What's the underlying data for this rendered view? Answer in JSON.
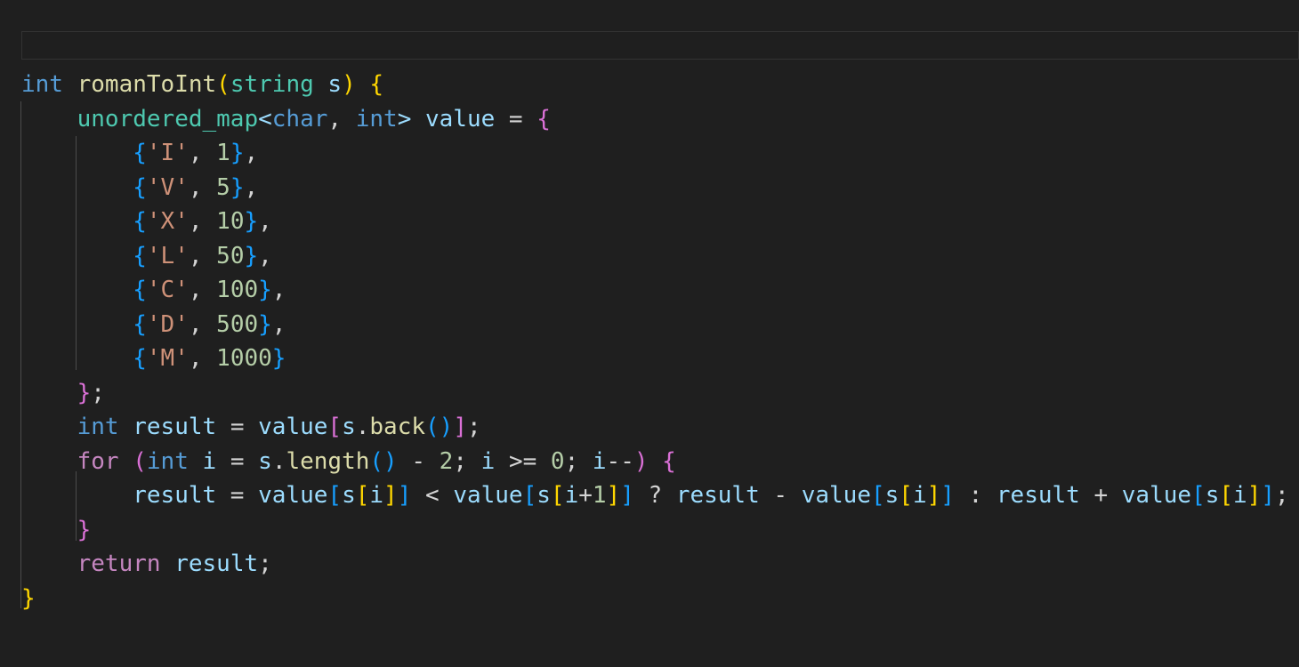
{
  "window": {
    "background_color": "#1f1f1f",
    "app_kind": "code-editor"
  },
  "topbar": {
    "name": "empty-tab-strip",
    "value": "",
    "placeholder": "",
    "border_color": "#333333"
  },
  "editor": {
    "language": "cpp",
    "font_size_px": 26,
    "line_height_px": 38.5,
    "theme": "Dark Modern",
    "indent_guides": true,
    "colors": {
      "keyword": "#569cd6",
      "control": "#c586c0",
      "type": "#4ec9b0",
      "function": "#dcdcaa",
      "variable": "#9cdcfe",
      "number": "#b5cea8",
      "string": "#ce9178",
      "operator": "#d4d4d4",
      "bracket_level_1": "#ffd700",
      "bracket_level_2": "#da70d6",
      "bracket_level_3": "#179fff",
      "indent_guide": "#4b4b4b",
      "background": "#1f1f1f"
    },
    "lines": [
      "int romanToInt(string s) {",
      "    unordered_map<char, int> value = {",
      "        {'I', 1},",
      "        {'V', 5},",
      "        {'X', 10},",
      "        {'L', 50},",
      "        {'C', 100},",
      "        {'D', 500},",
      "        {'M', 1000}",
      "    };",
      "    int result = value[s.back()];",
      "    for (int i = s.length() - 2; i >= 0; i--) {",
      "        result = value[s[i]] < value[s[i+1]] ? result - value[s[i]] : result + value[s[i]];",
      "    }",
      "    return result;",
      "}"
    ],
    "tokens": {
      "l1": {
        "kw_int": "int",
        "fn": "romanToInt",
        "paren_open": "(",
        "type": "string",
        "var": "s",
        "paren_close": ")",
        "brace": "{"
      },
      "l2": {
        "type": "unordered_map",
        "lt": "<",
        "kw_char": "char",
        "comma": ", ",
        "kw_int": "int",
        "gt": "> ",
        "var": "value",
        "eq": " = ",
        "brace": "{"
      },
      "l3": {
        "open": "{",
        "chr": "'I'",
        "comma": ", ",
        "num": "1",
        "close": "}",
        "tail": ","
      },
      "l4": {
        "open": "{",
        "chr": "'V'",
        "comma": ", ",
        "num": "5",
        "close": "}",
        "tail": ","
      },
      "l5": {
        "open": "{",
        "chr": "'X'",
        "comma": ", ",
        "num": "10",
        "close": "}",
        "tail": ","
      },
      "l6": {
        "open": "{",
        "chr": "'L'",
        "comma": ", ",
        "num": "50",
        "close": "}",
        "tail": ","
      },
      "l7": {
        "open": "{",
        "chr": "'C'",
        "comma": ", ",
        "num": "100",
        "close": "}",
        "tail": ","
      },
      "l8": {
        "open": "{",
        "chr": "'D'",
        "comma": ", ",
        "num": "500",
        "close": "}",
        "tail": ","
      },
      "l9": {
        "open": "{",
        "chr": "'M'",
        "comma": ", ",
        "num": "1000",
        "close": "}"
      },
      "l10": {
        "close": "}",
        "semi": ";"
      },
      "l11": {
        "kw_int": "int",
        "var_result": "result",
        "eq": " = ",
        "var_value": "value",
        "br_open": "[",
        "var_s": "s",
        "dot": ".",
        "fn": "back",
        "paren_open": "(",
        "paren_close": ")",
        "br_close": "]",
        "semi": ";"
      },
      "l12": {
        "ctrl": "for",
        "paren_open": "(",
        "kw_int": "int",
        "var_i": "i",
        "eq": " = ",
        "var_s": "s",
        "dot": ".",
        "fn": "length",
        "p2_open": "(",
        "p2_close": ")",
        "minus": " - ",
        "num2": "2",
        "semi1": "; ",
        "var_i2": "i",
        "ge": " >= ",
        "num0": "0",
        "semi2": "; ",
        "var_i3": "i",
        "dec": "--",
        "paren_close": ")",
        "brace": "{"
      },
      "l13": {
        "var_result": "result",
        "eq": " = ",
        "var_value": "value",
        "br1": "[",
        "var_s": "s",
        "br2": "[",
        "var_i": "i",
        "br2c": "]",
        "br1c": "]",
        "lt": " < ",
        "plus1": "+",
        "num1": "1",
        "q": " ? ",
        "minus": " - ",
        "colon": " : ",
        "plus": " + ",
        "semi": ";"
      },
      "l14": {
        "close": "}"
      },
      "l15": {
        "ctrl": "return",
        "var": "result",
        "semi": ";"
      },
      "l16": {
        "close": "}"
      }
    }
  }
}
